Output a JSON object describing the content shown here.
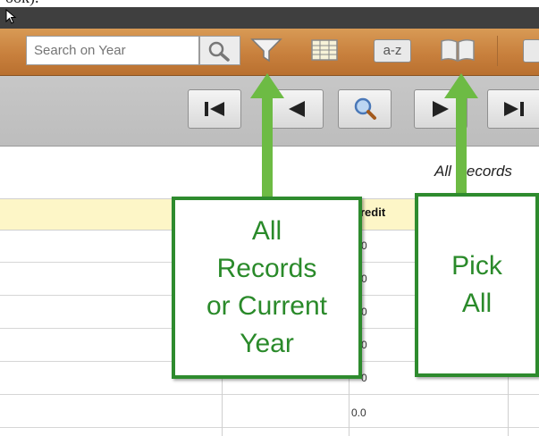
{
  "window": {
    "top_text": "ook)."
  },
  "toolbar": {
    "search": {
      "placeholder": "Search on Year"
    },
    "buttons": [
      {
        "icon": "magnifier-icon",
        "name": "search-button"
      },
      {
        "icon": "funnel-filter-icon",
        "name": "filter-button"
      },
      {
        "icon": "table-grid-icon",
        "name": "table-view-button"
      },
      {
        "icon": "sort-az-icon",
        "name": "sort-button",
        "label": "a-z"
      },
      {
        "icon": "open-book-icon",
        "name": "pick-all-button"
      }
    ]
  },
  "navigation": {
    "buttons": [
      "first-record-icon",
      "previous-record-icon",
      "find-icon",
      "next-record-icon",
      "last-record-icon"
    ]
  },
  "view": {
    "records_label": "All Records"
  },
  "table": {
    "visible_header": "redit",
    "rows": [
      "0",
      "0",
      "0",
      "0",
      "0",
      "0.0"
    ]
  },
  "callouts": {
    "left": {
      "lines": [
        "All",
        "Records",
        "or Current",
        "Year"
      ]
    },
    "right": {
      "lines": [
        "Pick",
        "All"
      ]
    }
  },
  "colors": {
    "toolbar": "#c8803d",
    "callout_border": "#2e8b2e",
    "callout_text": "#2a8a2a",
    "arrow": "#6dbb44",
    "header_row": "#fdf6c7"
  }
}
